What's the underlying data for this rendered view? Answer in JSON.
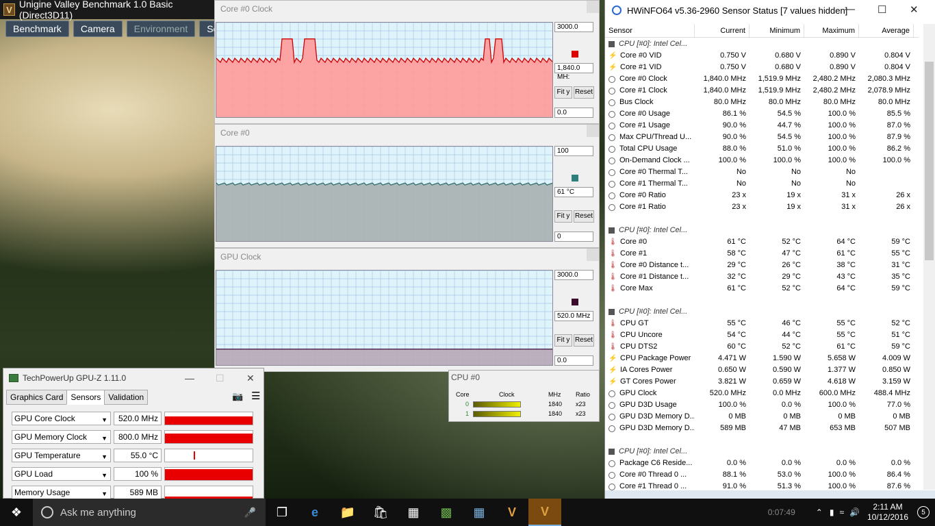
{
  "valley": {
    "title": "Unigine Valley Benchmark 1.0 Basic (Direct3D11)",
    "menu": [
      "Benchmark",
      "Camera",
      "Environment",
      "Se"
    ]
  },
  "graphs": [
    {
      "title": "Core #0 Clock",
      "max": "3000.0",
      "current": "1,840.0 MH:",
      "min": "0.0",
      "fit": "Fit y",
      "reset": "Reset",
      "color": "#e00000",
      "fill": "#ff9a9a",
      "line": "#cc0000",
      "level": 0.6
    },
    {
      "title": "Core #0",
      "max": "100",
      "current": "61 °C",
      "min": "0",
      "fit": "Fit y",
      "reset": "Reset",
      "color": "#2f7f7f",
      "fill": "#a8b0b0",
      "line": "#2f6f6f",
      "level": 0.61
    },
    {
      "title": "GPU Clock",
      "max": "3000.0",
      "current": "520.0 MHz",
      "min": "0.0",
      "fit": "Fit y",
      "reset": "Reset",
      "color": "#3a0a2a",
      "fill": "#b8a8b8",
      "line": "#3a0a3a",
      "level": 0.173
    }
  ],
  "gpuz": {
    "title": "TechPowerUp GPU-Z 1.11.0",
    "tabs": [
      "Graphics Card",
      "Sensors",
      "Validation"
    ],
    "rows": [
      {
        "name": "GPU Core Clock",
        "value": "520.0 MHz",
        "level": 0.78
      },
      {
        "name": "GPU Memory Clock",
        "value": "800.0 MHz",
        "level": 0.85
      },
      {
        "name": "GPU Temperature",
        "value": "55.0 °C",
        "level": 0.4
      },
      {
        "name": "GPU Load",
        "value": "100 %",
        "level": 1.0
      },
      {
        "name": "Memory Usage",
        "value": "589 MB",
        "level": 0.2
      }
    ]
  },
  "cpuw": {
    "title": "CPU #0",
    "head": [
      "Core",
      "Clock",
      "MHz",
      "Ratio"
    ],
    "rows": [
      {
        "core": "0",
        "mhz": "1840",
        "ratio": "x23"
      },
      {
        "core": "1",
        "mhz": "1840",
        "ratio": "x23"
      }
    ]
  },
  "hwinfo": {
    "title": "HWiNFO64 v5.36-2960 Sensor Status [7 values hidden]",
    "columns": [
      "Sensor",
      "Current",
      "Minimum",
      "Maximum",
      "Average"
    ],
    "rows": [
      {
        "type": "group",
        "name": "CPU [#0]: Intel Cel..."
      },
      {
        "icon": "v",
        "name": "Core #0 VID",
        "cur": "0.750 V",
        "min": "0.680 V",
        "max": "0.890 V",
        "avg": "0.804 V"
      },
      {
        "icon": "v",
        "name": "Core #1 VID",
        "cur": "0.750 V",
        "min": "0.680 V",
        "max": "0.890 V",
        "avg": "0.804 V"
      },
      {
        "icon": "cl",
        "name": "Core #0 Clock",
        "cur": "1,840.0 MHz",
        "min": "1,519.9 MHz",
        "max": "2,480.2 MHz",
        "avg": "2,080.3 MHz"
      },
      {
        "icon": "cl",
        "name": "Core #1 Clock",
        "cur": "1,840.0 MHz",
        "min": "1,519.9 MHz",
        "max": "2,480.2 MHz",
        "avg": "2,078.9 MHz"
      },
      {
        "icon": "cl",
        "name": "Bus Clock",
        "cur": "80.0 MHz",
        "min": "80.0 MHz",
        "max": "80.0 MHz",
        "avg": "80.0 MHz"
      },
      {
        "icon": "cl",
        "name": "Core #0 Usage",
        "cur": "86.1 %",
        "min": "54.5 %",
        "max": "100.0 %",
        "avg": "85.5 %"
      },
      {
        "icon": "cl",
        "name": "Core #1 Usage",
        "cur": "90.0 %",
        "min": "44.7 %",
        "max": "100.0 %",
        "avg": "87.0 %"
      },
      {
        "icon": "cl",
        "name": "Max CPU/Thread U...",
        "cur": "90.0 %",
        "min": "54.5 %",
        "max": "100.0 %",
        "avg": "87.9 %"
      },
      {
        "icon": "cl",
        "name": "Total CPU Usage",
        "cur": "88.0 %",
        "min": "51.0 %",
        "max": "100.0 %",
        "avg": "86.2 %"
      },
      {
        "icon": "cl",
        "name": "On-Demand Clock ...",
        "cur": "100.0 %",
        "min": "100.0 %",
        "max": "100.0 %",
        "avg": "100.0 %"
      },
      {
        "icon": "cl",
        "name": "Core #0 Thermal T...",
        "cur": "No",
        "min": "No",
        "max": "No",
        "avg": ""
      },
      {
        "icon": "cl",
        "name": "Core #1 Thermal T...",
        "cur": "No",
        "min": "No",
        "max": "No",
        "avg": ""
      },
      {
        "icon": "cl",
        "name": "Core #0 Ratio",
        "cur": "23 x",
        "min": "19 x",
        "max": "31 x",
        "avg": "26 x"
      },
      {
        "icon": "cl",
        "name": "Core #1 Ratio",
        "cur": "23 x",
        "min": "19 x",
        "max": "31 x",
        "avg": "26 x"
      },
      {
        "type": "space"
      },
      {
        "type": "group",
        "name": "CPU [#0]: Intel Cel..."
      },
      {
        "icon": "t",
        "name": "Core #0",
        "cur": "61 °C",
        "min": "52 °C",
        "max": "64 °C",
        "avg": "59 °C"
      },
      {
        "icon": "t",
        "name": "Core #1",
        "cur": "58 °C",
        "min": "47 °C",
        "max": "61 °C",
        "avg": "55 °C"
      },
      {
        "icon": "t",
        "name": "Core #0 Distance t...",
        "cur": "29 °C",
        "min": "26 °C",
        "max": "38 °C",
        "avg": "31 °C"
      },
      {
        "icon": "t",
        "name": "Core #1 Distance t...",
        "cur": "32 °C",
        "min": "29 °C",
        "max": "43 °C",
        "avg": "35 °C"
      },
      {
        "icon": "t",
        "name": "Core Max",
        "cur": "61 °C",
        "min": "52 °C",
        "max": "64 °C",
        "avg": "59 °C"
      },
      {
        "type": "space"
      },
      {
        "type": "group",
        "name": "CPU [#0]: Intel Cel..."
      },
      {
        "icon": "t",
        "name": "CPU GT",
        "cur": "55 °C",
        "min": "46 °C",
        "max": "55 °C",
        "avg": "52 °C"
      },
      {
        "icon": "t",
        "name": "CPU Uncore",
        "cur": "54 °C",
        "min": "44 °C",
        "max": "55 °C",
        "avg": "51 °C"
      },
      {
        "icon": "t",
        "name": "CPU DTS2",
        "cur": "60 °C",
        "min": "52 °C",
        "max": "61 °C",
        "avg": "59 °C"
      },
      {
        "icon": "v",
        "name": "CPU Package Power",
        "cur": "4.471 W",
        "min": "1.590 W",
        "max": "5.658 W",
        "avg": "4.009 W"
      },
      {
        "icon": "v",
        "name": "IA Cores Power",
        "cur": "0.650 W",
        "min": "0.590 W",
        "max": "1.377 W",
        "avg": "0.850 W"
      },
      {
        "icon": "v",
        "name": "GT Cores Power",
        "cur": "3.821 W",
        "min": "0.659 W",
        "max": "4.618 W",
        "avg": "3.159 W"
      },
      {
        "icon": "cl",
        "name": "GPU Clock",
        "cur": "520.0 MHz",
        "min": "0.0 MHz",
        "max": "600.0 MHz",
        "avg": "488.4 MHz"
      },
      {
        "icon": "cl",
        "name": "GPU D3D Usage",
        "cur": "100.0 %",
        "min": "0.0 %",
        "max": "100.0 %",
        "avg": "77.0 %"
      },
      {
        "icon": "cl",
        "name": "GPU D3D Memory D...",
        "cur": "0 MB",
        "min": "0 MB",
        "max": "0 MB",
        "avg": "0 MB"
      },
      {
        "icon": "cl",
        "name": "GPU D3D Memory D...",
        "cur": "589 MB",
        "min": "47 MB",
        "max": "653 MB",
        "avg": "507 MB"
      },
      {
        "type": "space"
      },
      {
        "type": "group",
        "name": "CPU [#0]: Intel Cel..."
      },
      {
        "icon": "cl",
        "name": "Package C6 Reside...",
        "cur": "0.0 %",
        "min": "0.0 %",
        "max": "0.0 %",
        "avg": "0.0 %"
      },
      {
        "icon": "cl",
        "name": "Core #0 Thread 0 ...",
        "cur": "88.1 %",
        "min": "53.0 %",
        "max": "100.0 %",
        "avg": "86.4 %"
      },
      {
        "icon": "cl",
        "name": "Core #1 Thread 0 ...",
        "cur": "91.0 %",
        "min": "51.3 %",
        "max": "100.0 %",
        "avg": "87.6 %"
      }
    ]
  },
  "taskbar": {
    "search": "Ask me anything",
    "time": "2:11 AM",
    "date": "10/12/2016",
    "notif": "5",
    "elapsed": "0:07:49"
  }
}
